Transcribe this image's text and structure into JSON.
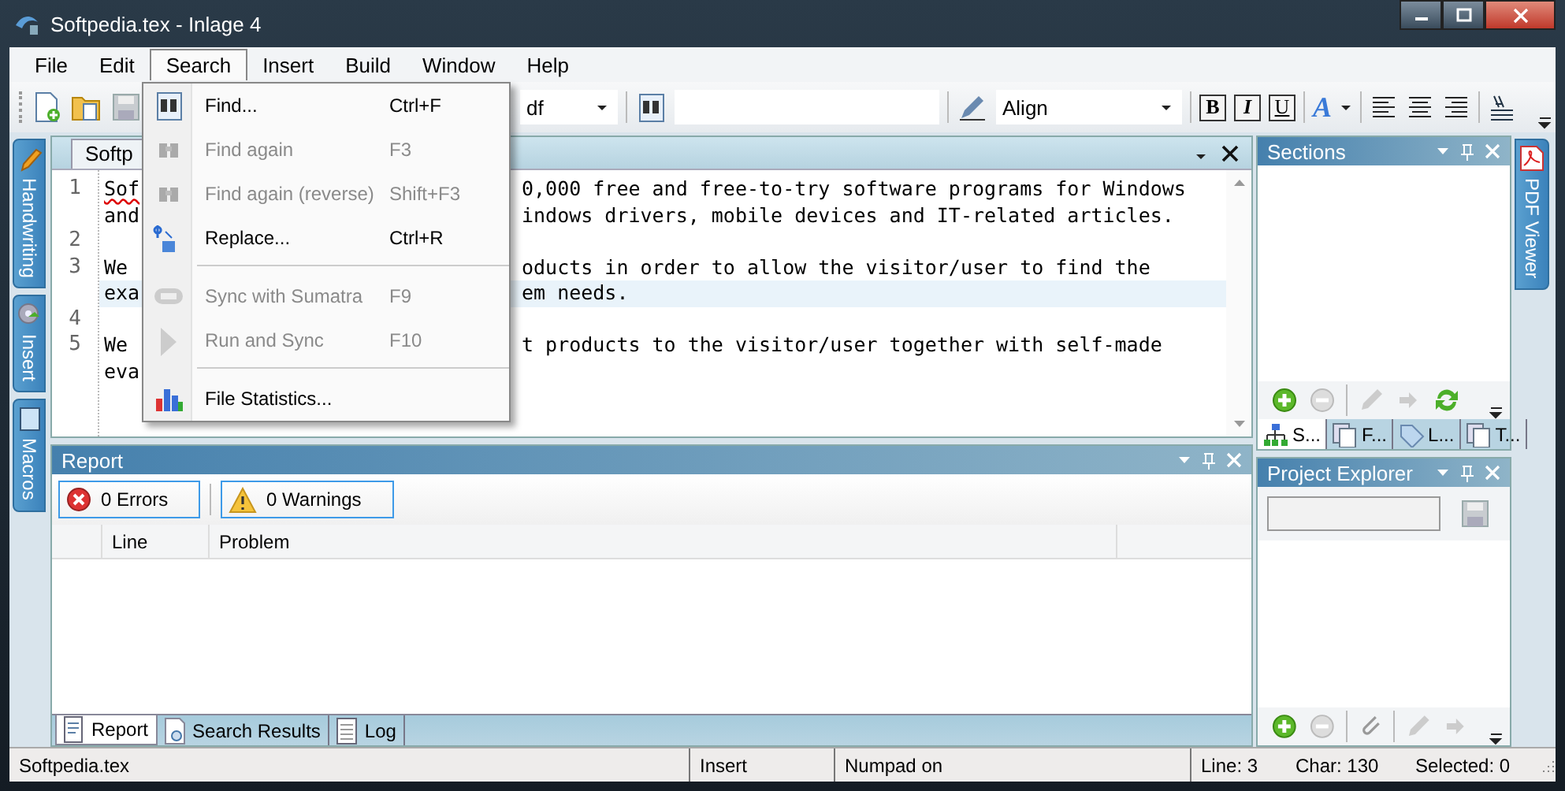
{
  "window": {
    "title": "Softpedia.tex - Inlage 4"
  },
  "menu_bar": [
    {
      "label": "File",
      "selected": false
    },
    {
      "label": "Edit",
      "selected": false
    },
    {
      "label": "Search",
      "selected": true
    },
    {
      "label": "Insert",
      "selected": false
    },
    {
      "label": "Build",
      "selected": false
    },
    {
      "label": "Window",
      "selected": false
    },
    {
      "label": "Help",
      "selected": false
    }
  ],
  "search_menu": [
    {
      "kind": "item",
      "label": "Find...",
      "shortcut": "Ctrl+F",
      "disabled": false
    },
    {
      "kind": "item",
      "label": "Find again",
      "shortcut": "F3",
      "disabled": true
    },
    {
      "kind": "item",
      "label": "Find again (reverse)",
      "shortcut": "Shift+F3",
      "disabled": true
    },
    {
      "kind": "item",
      "label": "Replace...",
      "shortcut": "Ctrl+R",
      "disabled": false
    },
    {
      "kind": "separator"
    },
    {
      "kind": "item",
      "label": "Sync with Sumatra",
      "shortcut": "F9",
      "disabled": true
    },
    {
      "kind": "item",
      "label": "Run and Sync",
      "shortcut": "F10",
      "disabled": true
    },
    {
      "kind": "separator"
    },
    {
      "kind": "item",
      "label": "File Statistics...",
      "disabled": false
    }
  ],
  "toolbar": {
    "font_dropdown": "df",
    "align_dropdown": "Align",
    "format_buttons": [
      "B",
      "I",
      "U"
    ],
    "font_color_button": "A"
  },
  "editor": {
    "tab": {
      "label": "Softp"
    },
    "lines": [
      {
        "number": "1",
        "rows": [
          {
            "left": "Sof",
            "right": "0,000 free and free-to-try software programs for Windows",
            "current": false,
            "misspelled": true
          },
          {
            "left": "and",
            "right": "indows drivers, mobile devices and IT-related articles.",
            "current": false,
            "misspelled": false
          }
        ]
      },
      {
        "number": "2"
      },
      {
        "number": "3",
        "rows": [
          {
            "left": "We",
            "right": "oducts in order to allow the visitor/user to find the",
            "current": false,
            "misspelled": false
          },
          {
            "left": "exa",
            "right": "em needs.",
            "current": true,
            "misspelled": false
          }
        ]
      },
      {
        "number": "4"
      },
      {
        "number": "5",
        "rows": [
          {
            "left": "We",
            "right": "t products to the visitor/user together with self-made",
            "current": false,
            "misspelled": false
          },
          {
            "left": "eva",
            "current": false,
            "misspelled": false
          }
        ]
      }
    ]
  },
  "left_tabs": [
    {
      "label": "Handwriting"
    },
    {
      "label": "Insert"
    },
    {
      "label": "Macros"
    }
  ],
  "report_panel": {
    "title": "Report",
    "filters": [
      "0 Errors",
      "0 Warnings"
    ],
    "columns": [
      "Line",
      "Problem"
    ],
    "tabs": [
      {
        "label": "Report",
        "selected": true
      },
      {
        "label": "Search Results",
        "selected": false
      },
      {
        "label": "Log",
        "selected": false
      }
    ]
  },
  "sections_panel": {
    "title": "Sections",
    "tabs": [
      {
        "label": "S...",
        "selected": true
      },
      {
        "label": "F...",
        "selected": false
      },
      {
        "label": "L...",
        "selected": false
      },
      {
        "label": "T...",
        "selected": false
      }
    ]
  },
  "project_panel": {
    "title": "Project Explorer"
  },
  "right_tabs": [
    {
      "label": "PDF Viewer"
    }
  ],
  "status_bar": [
    "Softpedia.tex",
    "Insert",
    "Numpad on",
    "Line: 3",
    "Char: 130",
    "Selected: 0"
  ]
}
